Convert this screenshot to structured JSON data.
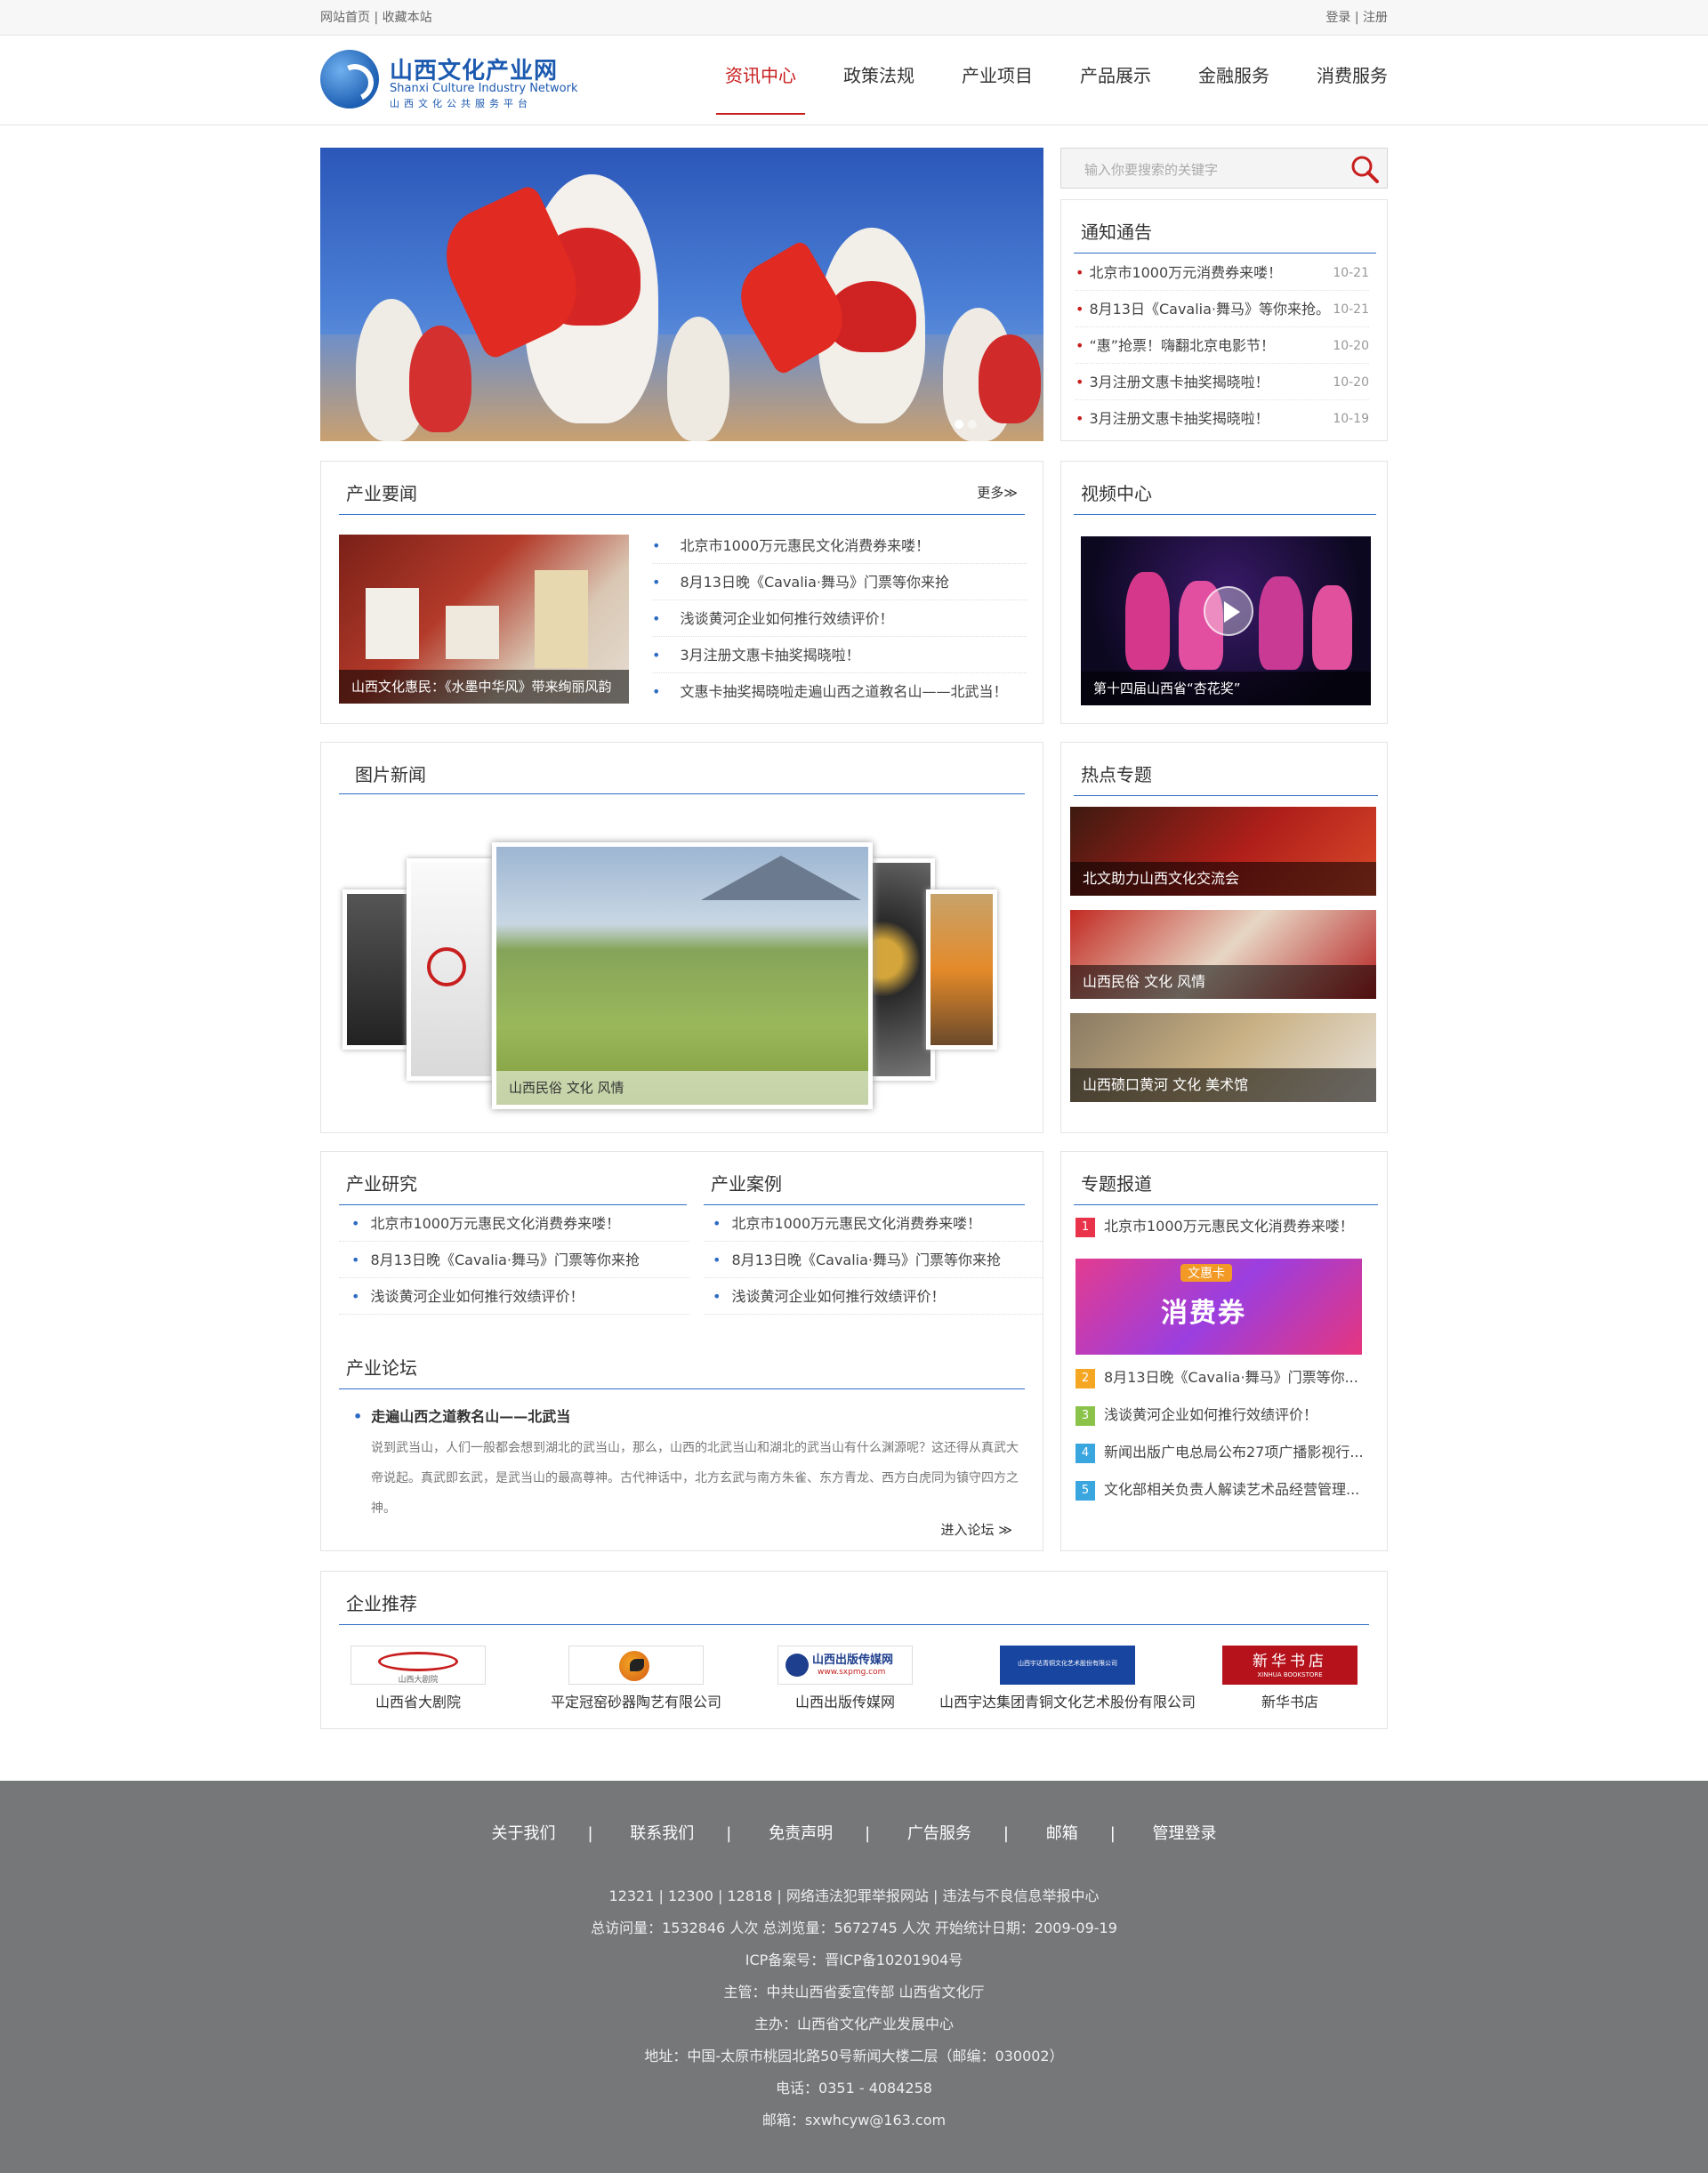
{
  "topbar": {
    "home": "网站首页",
    "fav": "收藏本站",
    "sep": " | ",
    "login": "登录",
    "reg": "注册"
  },
  "logo": {
    "cn": "山西文化产业网",
    "en": "Shanxi Culture Industry Network",
    "sub": "山西文化公共服务平台"
  },
  "nav": [
    {
      "label": "资讯中心",
      "active": true
    },
    {
      "label": "政策法规"
    },
    {
      "label": "产业项目"
    },
    {
      "label": "产品展示"
    },
    {
      "label": "金融服务"
    },
    {
      "label": "消费服务"
    }
  ],
  "search": {
    "placeholder": "输入你要搜索的关键字"
  },
  "notice": {
    "title": "通知通告",
    "items": [
      {
        "text": "北京市1000万元消费券来喽！",
        "date": "10-21"
      },
      {
        "text": "8月13日《Cavalia·舞马》等你来抢。",
        "date": "10-21"
      },
      {
        "text": "“惠”抢票！嗨翻北京电影节！",
        "date": "10-20"
      },
      {
        "text": "3月注册文惠卡抽奖揭晓啦！",
        "date": "10-20"
      },
      {
        "text": "3月注册文惠卡抽奖揭晓啦！",
        "date": "10-19"
      }
    ]
  },
  "industry_news": {
    "title": "产业要闻",
    "more": "更多≫",
    "img_caption": "山西文化惠民：《水墨中华风》带来绚丽风韵",
    "items": [
      "北京市1000万元惠民文化消费券来喽！",
      "8月13日晚《Cavalia·舞马》门票等你来抢",
      "浅谈黄河企业如何推行效绩评价！",
      "3月注册文惠卡抽奖揭晓啦！",
      "文惠卡抽奖揭晓啦走遍山西之道教名山——北武当！"
    ]
  },
  "video": {
    "title": "视频中心",
    "caption": "第十四届山西省“杏花奖”"
  },
  "photo_news": {
    "title": "图片新闻",
    "caption": "山西民俗 文化 风情"
  },
  "hot": {
    "title": "热点专题",
    "items": [
      "北文助力山西文化交流会",
      "山西民俗 文化 风情",
      "山西碛口黄河 文化 美术馆"
    ]
  },
  "research": {
    "title": "产业研究",
    "items": [
      "北京市1000万元惠民文化消费券来喽！",
      "8月13日晚《Cavalia·舞马》门票等你来抢",
      "浅谈黄河企业如何推行效绩评价！"
    ]
  },
  "cases": {
    "title": "产业案例",
    "items": [
      "北京市1000万元惠民文化消费券来喽！",
      "8月13日晚《Cavalia·舞马》门票等你来抢",
      "浅谈黄河企业如何推行效绩评价！"
    ]
  },
  "forum": {
    "title": "产业论坛",
    "headline": "走遍山西之道教名山——北武当",
    "body": "说到武当山，人们一般都会想到湖北的武当山，那么，山西的北武当山和湖北的武当山有什么渊源呢？这还得从真武大帝说起。真武即玄武，是武当山的最高尊神。古代神话中，北方玄武与南方朱雀、东方青龙、西方白虎同为镇守四方之神。",
    "enter": "进入论坛 ≫"
  },
  "special": {
    "title": "专题报道",
    "banner_a": "文惠卡",
    "banner_b": "消费券",
    "items": [
      {
        "n": "1",
        "text": "北京市1000万元惠民文化消费券来喽！",
        "color": "#e8334a"
      },
      {
        "n": "2",
        "text": "8月13日晚《Cavalia·舞马》门票等你...",
        "color": "#f5a623"
      },
      {
        "n": "3",
        "text": "浅谈黄河企业如何推行效绩评价！",
        "color": "#8bc34a"
      },
      {
        "n": "4",
        "text": "新闻出版广电总局公布27项广播影视行...",
        "color": "#3aa6e0"
      },
      {
        "n": "5",
        "text": "文化部相关负责人解读艺术品经营管理...",
        "color": "#3aa6e0"
      }
    ]
  },
  "partners": {
    "title": "企业推荐",
    "items": [
      {
        "name": "山西省大剧院",
        "logo": "山西大剧院"
      },
      {
        "name": "平定冠窑砂器陶艺有限公司",
        "logo": ""
      },
      {
        "name": "山西出版传媒网",
        "logo": "山西出版传媒网",
        "logo_sub": "www.sxpmg.com"
      },
      {
        "name": "山西宇达集团青铜文化艺术股份有限公司",
        "logo": "山西宇达青铜文化艺术股份有限公司"
      },
      {
        "name": "新华书店",
        "logo": "新华书店",
        "logo_sub": "XINHUA BOOKSTORE"
      }
    ]
  },
  "footer": {
    "links": [
      "关于我们",
      "联系我们",
      "免责声明",
      "广告服务",
      "邮箱",
      "管理登录"
    ],
    "sep": "|",
    "lines": [
      "12321 | 12300 | 12818 | 网络违法犯罪举报网站 | 违法与不良信息举报中心",
      "总访问量：1532846 人次  总浏览量：5672745 人次  开始统计日期：2009-09-19",
      "ICP备案号：晋ICP备10201904号",
      "主管：中共山西省委宣传部 山西省文化厅",
      "主办：山西省文化产业发展中心",
      "地址：中国-太原市桃园北路50号新闻大楼二层（邮编：030002）",
      "电话：0351 - 4084258",
      "邮箱：sxwhcyw@163.com"
    ]
  }
}
